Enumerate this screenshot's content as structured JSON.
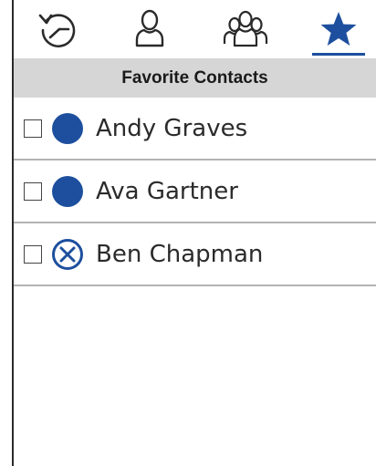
{
  "colors": {
    "accent": "#1d4f9e",
    "header_bg": "#d6d6d6",
    "divider": "#b3b3b3",
    "icon_stroke": "#2a2a2a"
  },
  "tabs": [
    {
      "icon": "history-icon",
      "selected": false
    },
    {
      "icon": "person-icon",
      "selected": false
    },
    {
      "icon": "group-icon",
      "selected": false
    },
    {
      "icon": "star-icon",
      "selected": true
    }
  ],
  "header": {
    "title": "Favorite Contacts"
  },
  "contacts": [
    {
      "name": "Andy Graves",
      "status_icon": "filled-circle-icon",
      "checked": false
    },
    {
      "name": "Ava Gartner",
      "status_icon": "filled-circle-icon",
      "checked": false
    },
    {
      "name": "Ben Chapman",
      "status_icon": "circle-x-icon",
      "checked": false
    }
  ]
}
